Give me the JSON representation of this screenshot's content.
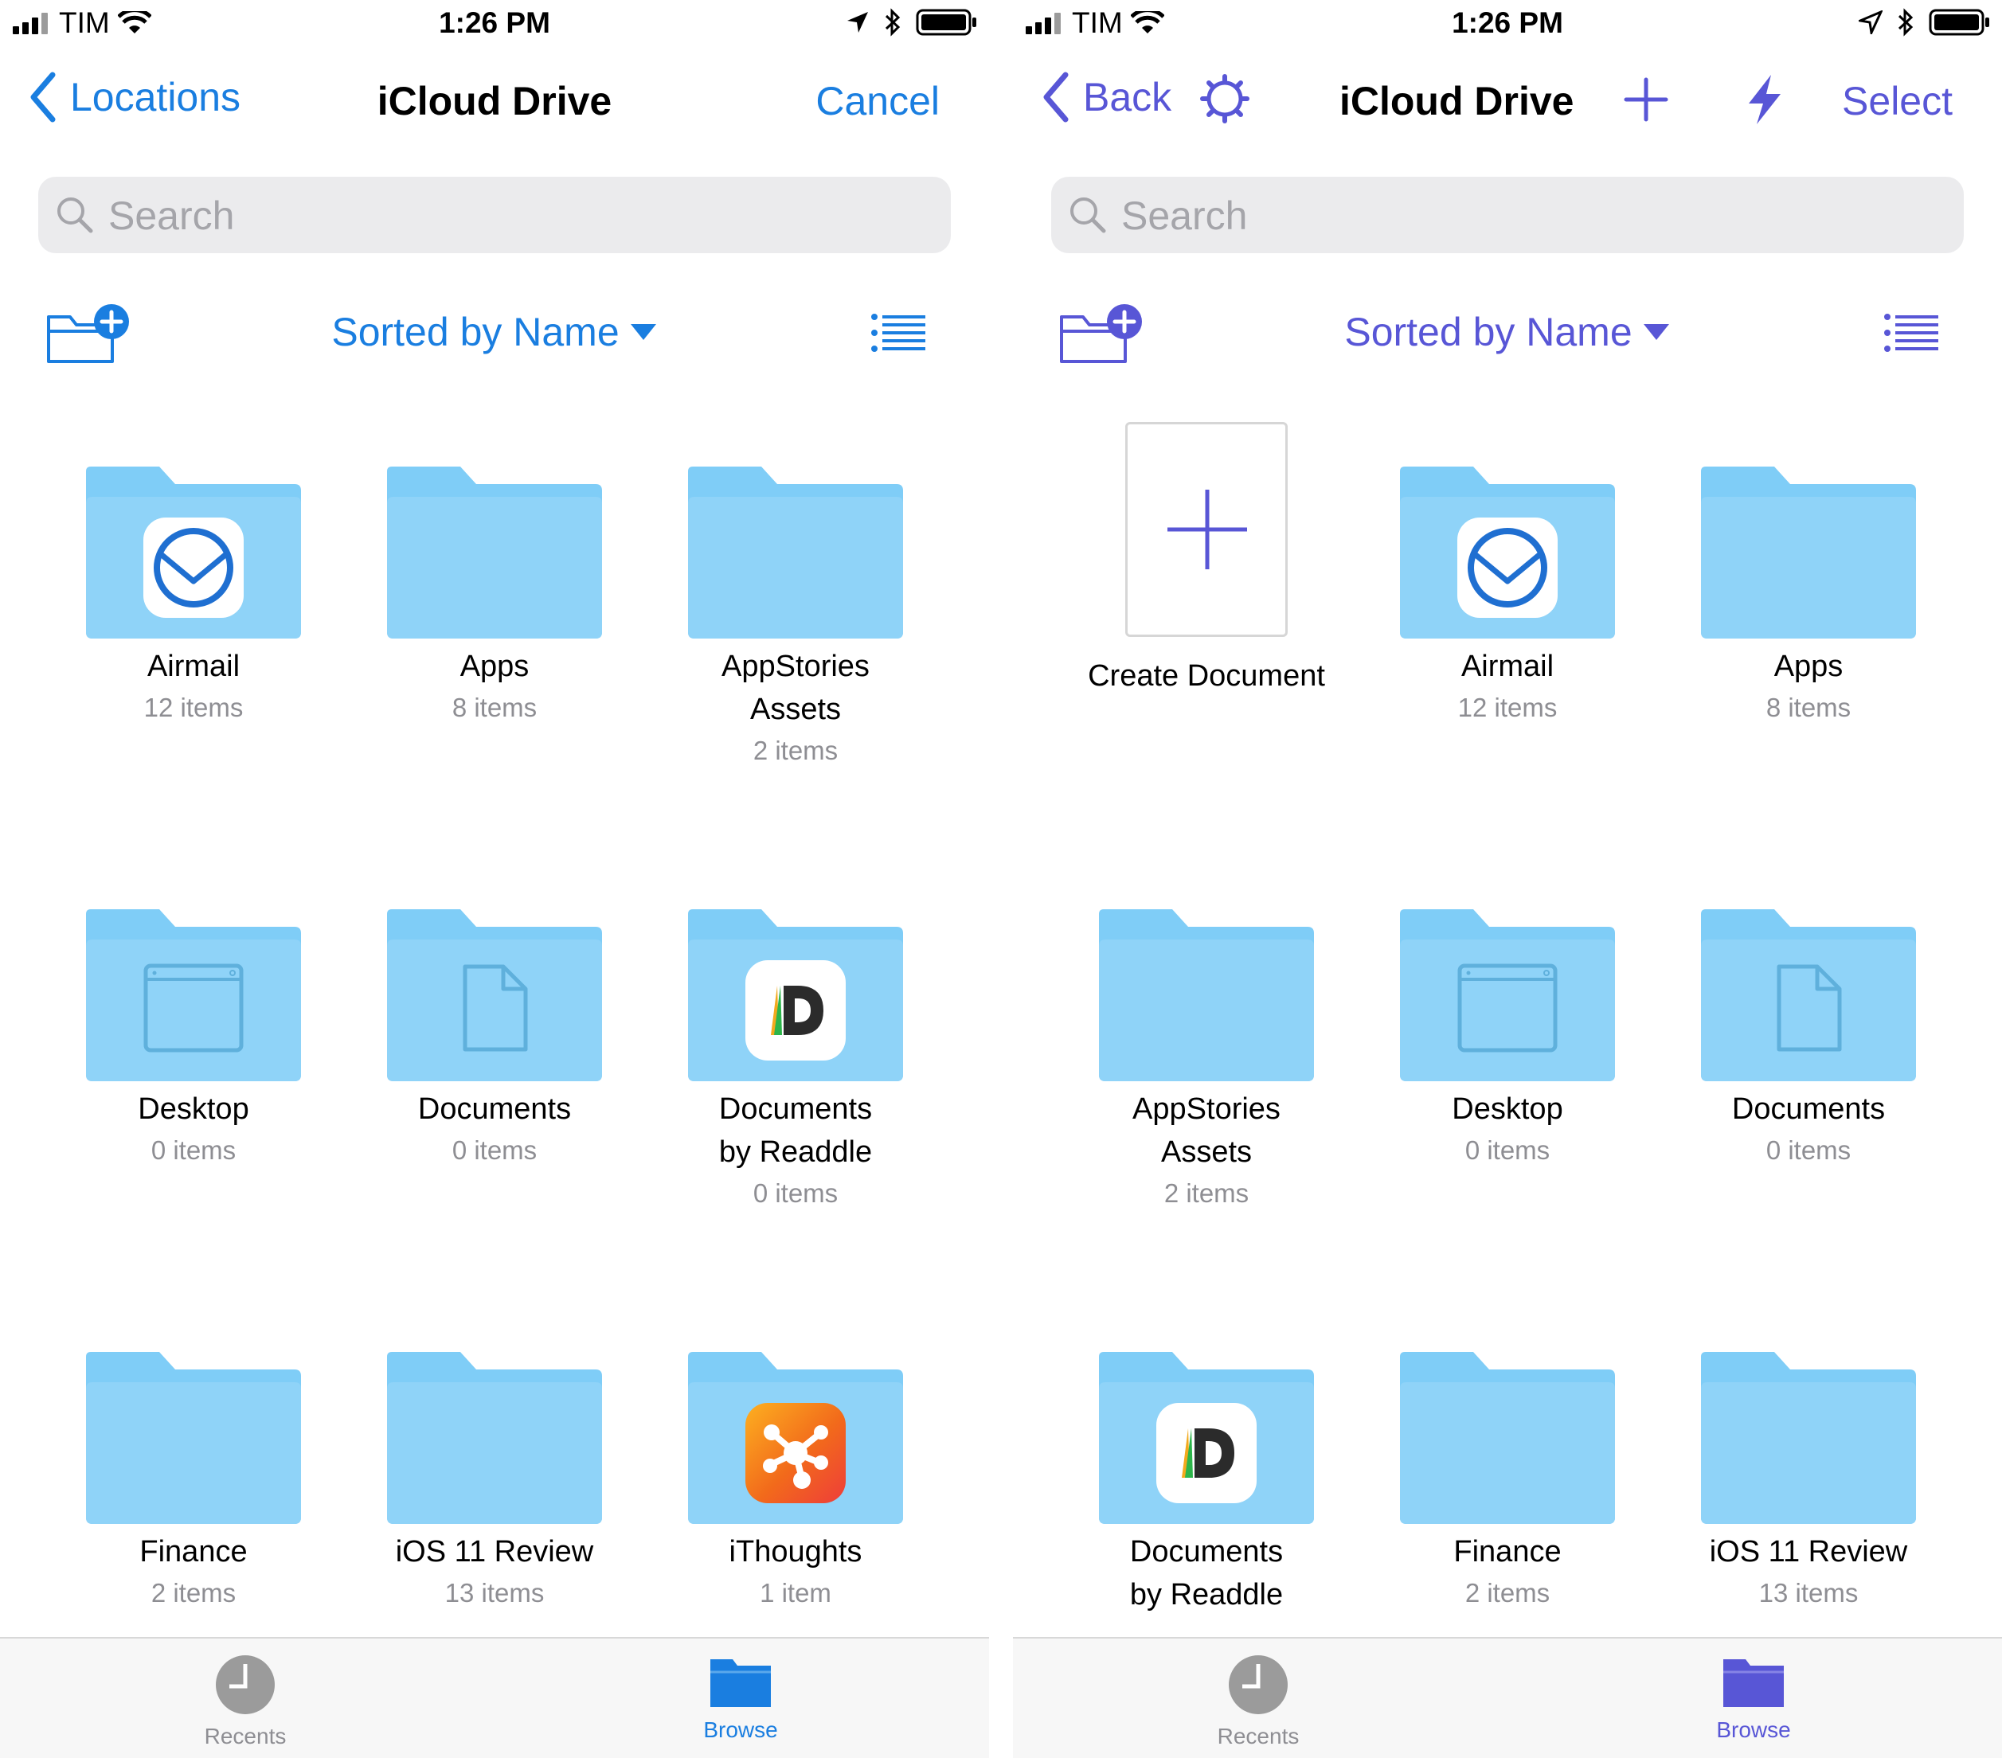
{
  "left": {
    "accent": "#1a7ee0",
    "status": {
      "carrier": "TIM",
      "time": "1:26 PM"
    },
    "nav": {
      "back_label": "Locations",
      "title": "iCloud Drive",
      "action_label": "Cancel"
    },
    "search": {
      "placeholder": "Search"
    },
    "sort": {
      "label": "Sorted by Name"
    },
    "items": [
      {
        "name": "Airmail",
        "name2": "",
        "count": "12 items",
        "icon": "airmail-icon"
      },
      {
        "name": "Apps",
        "name2": "",
        "count": "8 items",
        "icon": ""
      },
      {
        "name": "AppStories",
        "name2": "Assets",
        "count": "2 items",
        "icon": ""
      },
      {
        "name": "Desktop",
        "name2": "",
        "count": "0 items",
        "icon": "desktop-window-icon"
      },
      {
        "name": "Documents",
        "name2": "",
        "count": "0 items",
        "icon": "document-icon"
      },
      {
        "name": "Documents",
        "name2": "by Readdle",
        "count": "0 items",
        "icon": "readdle-documents-icon"
      },
      {
        "name": "Finance",
        "name2": "",
        "count": "2 items",
        "icon": ""
      },
      {
        "name": "iOS 11 Review",
        "name2": "",
        "count": "13 items",
        "icon": ""
      },
      {
        "name": "iThoughts",
        "name2": "",
        "count": "1 item",
        "icon": "ithoughts-icon"
      }
    ],
    "tabs": [
      {
        "label": "Recents",
        "icon": "clock-icon"
      },
      {
        "label": "Browse",
        "icon": "folder-icon"
      }
    ]
  },
  "right": {
    "accent": "#5856d6",
    "status": {
      "carrier": "TIM",
      "time": "1:26 PM"
    },
    "nav": {
      "back_label": "Back",
      "title": "iCloud Drive",
      "action_label": "Select"
    },
    "search": {
      "placeholder": "Search"
    },
    "sort": {
      "label": "Sorted by Name"
    },
    "create": {
      "label": "Create Document"
    },
    "items": [
      {
        "name": "Airmail",
        "name2": "",
        "count": "12 items",
        "icon": "airmail-icon"
      },
      {
        "name": "Apps",
        "name2": "",
        "count": "8 items",
        "icon": ""
      },
      {
        "name": "AppStories",
        "name2": "Assets",
        "count": "2 items",
        "icon": ""
      },
      {
        "name": "Desktop",
        "name2": "",
        "count": "0 items",
        "icon": "desktop-window-icon"
      },
      {
        "name": "Documents",
        "name2": "",
        "count": "0 items",
        "icon": "document-icon"
      },
      {
        "name": "Documents",
        "name2": "by Readdle",
        "count": "",
        "icon": "readdle-documents-icon"
      },
      {
        "name": "Finance",
        "name2": "",
        "count": "2 items",
        "icon": ""
      },
      {
        "name": "iOS 11 Review",
        "name2": "",
        "count": "13 items",
        "icon": ""
      }
    ],
    "tabs": [
      {
        "label": "Recents",
        "icon": "clock-icon"
      },
      {
        "label": "Browse",
        "icon": "folder-icon"
      }
    ]
  },
  "colors": {
    "folder_light": "#8fd3f8",
    "folder_back": "#7fcdf7",
    "inactive_gray": "#8e8e93"
  }
}
